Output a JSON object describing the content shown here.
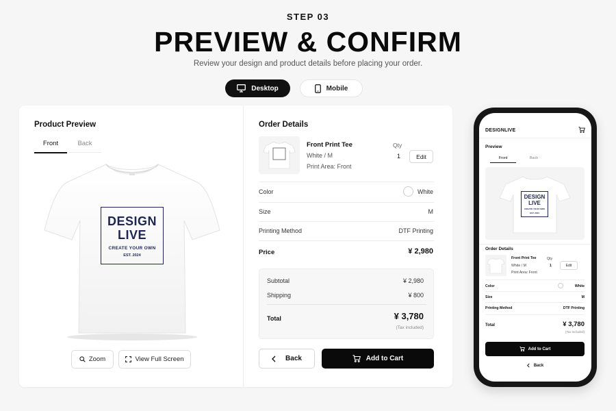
{
  "header": {
    "step": "STEP 03",
    "title": "PREVIEW & CONFIRM",
    "subtitle": "Review your design and product details before placing your order."
  },
  "view_toggle": {
    "desktop_label": "Desktop",
    "mobile_label": "Mobile",
    "selected": "Desktop"
  },
  "preview": {
    "title": "Product Preview",
    "tabs": [
      "Front",
      "Back"
    ],
    "active_tab": "Front",
    "print": {
      "line1": "DESIGN",
      "line2": "LIVE",
      "tagline": "CREATE YOUR OWN",
      "est": "EST. 2024"
    },
    "zoom_label": "Zoom",
    "fullscreen_label": "View Full Screen"
  },
  "order": {
    "title": "Order Details",
    "product_name": "Front Print Tee",
    "variant": "White / M",
    "print_area": "Print Area: Front",
    "qty_label": "Qty",
    "qty": "1",
    "edit_label": "Edit",
    "rows": [
      {
        "label": "Color",
        "value": "White"
      },
      {
        "label": "Size",
        "value": "M"
      },
      {
        "label": "Printing Method",
        "value": "DTF Printing"
      }
    ],
    "price_label": "Price",
    "price": "¥ 2,980",
    "summary": {
      "subtotal_label": "Subtotal",
      "subtotal": "¥ 2,980",
      "shipping_label": "Shipping",
      "shipping": "¥ 800",
      "total_label": "Total",
      "total": "¥ 3,780",
      "tax_note": "(Tax included)"
    },
    "back_label": "Back",
    "cart_label": "Add to Cart"
  },
  "mobile": {
    "logo": "DESIGNLIVE",
    "preview_title": "Preview",
    "tabs": [
      "Front",
      "Back"
    ],
    "print": {
      "line1": "DESIGN",
      "line2": "LIVE",
      "tagline": "CREATE YOUR OWN",
      "est": "EST. 2024"
    },
    "order_title": "Order Details",
    "product_name": "Front Print Tee",
    "variant": "White / M",
    "print_area": "Print Area: Front",
    "qty_label": "Qty",
    "qty": "1",
    "edit_label": "Edit",
    "rows": [
      {
        "label": "Color",
        "value": "White"
      },
      {
        "label": "Size",
        "value": "M"
      },
      {
        "label": "Printing Method",
        "value": "DTF Printing"
      }
    ],
    "total_label": "Total",
    "total": "¥ 3,780",
    "tax_note": "(Tax included)",
    "cart_label": "Add to Cart",
    "back_label": "Back"
  },
  "colors": {
    "accent": "#0a0a0a",
    "print_navy": "#1e2550",
    "logo_ring": "#d0342c"
  }
}
